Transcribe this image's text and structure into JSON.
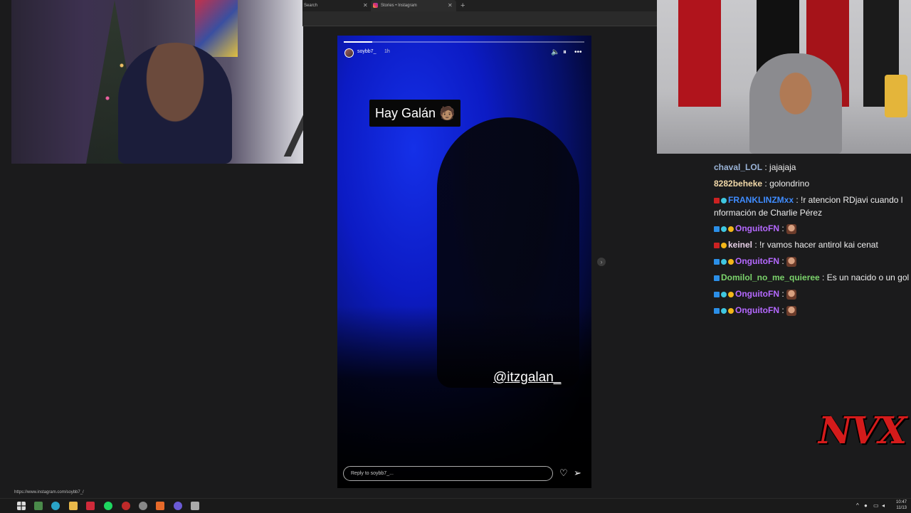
{
  "browser": {
    "tab1_label": "Search",
    "tab2_label": "Stories • Instagram",
    "new_tab": "+"
  },
  "story": {
    "username": "soybb7_",
    "time": "1h",
    "caption": "Hay Galán 🧑🏽",
    "mention": "@itzgalan_",
    "reply_placeholder": "Reply to soybb7_...",
    "background_color": "#0c1bc4"
  },
  "chat": {
    "messages": [
      {
        "user": "chaval_LOL",
        "color": "#9ab3d6",
        "text": "jajajaja",
        "badges": []
      },
      {
        "user": "8282beheke",
        "color": "#f1d8a8",
        "text": "golondrino",
        "badges": []
      },
      {
        "user": "FRANKLINZMxx",
        "color": "#3f8cff",
        "text": "!r atencion RDjavi cuando l",
        "cont": "nformación de Charlie Pérez",
        "badges": [
          "red",
          "cyan"
        ]
      },
      {
        "user": "OnguitoFN",
        "color": "#b569ff",
        "text": "",
        "emote": true,
        "badges": [
          "blue",
          "cyan",
          "gold"
        ]
      },
      {
        "user": "keinel",
        "color": "#e6d0e6",
        "text": "!r vamos hacer antirol kai cenat",
        "badges": [
          "red",
          "gold"
        ]
      },
      {
        "user": "OnguitoFN",
        "color": "#b569ff",
        "text": "",
        "emote": true,
        "badges": [
          "blue",
          "cyan",
          "gold"
        ]
      },
      {
        "user": "Domilol_no_me_quieree",
        "color": "#7bd36b",
        "text": "Es un nacido o un gol",
        "badges": [
          "blue"
        ]
      },
      {
        "user": "OnguitoFN",
        "color": "#b569ff",
        "text": "",
        "emote": true,
        "badges": [
          "blue",
          "cyan",
          "gold"
        ]
      },
      {
        "user": "OnguitoFN",
        "color": "#b569ff",
        "text": "",
        "emote": true,
        "badges": [
          "blue",
          "cyan",
          "gold"
        ]
      }
    ]
  },
  "overlay": {
    "logo": "NVX",
    "logo_color": "#d41b1b"
  },
  "status_url": "https://www.instagram.com/soybb7_/",
  "taskbar": {
    "clock_time": "10:47",
    "clock_date": "11/13"
  }
}
